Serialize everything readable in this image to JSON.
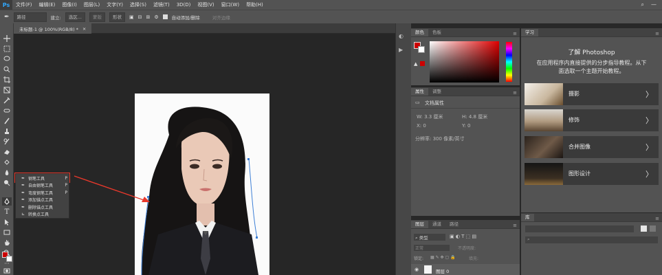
{
  "menubar": {
    "logo": "Ps",
    "items": [
      "文件(F)",
      "编辑(E)",
      "图像(I)",
      "图层(L)",
      "文字(Y)",
      "选择(S)",
      "滤镜(T)",
      "3D(D)",
      "视图(V)",
      "窗口(W)",
      "帮助(H)"
    ]
  },
  "options": {
    "mode": "路径",
    "make_label": "建立:",
    "selection_btn": "选区...",
    "mask_btn": "蒙版",
    "shape_btn": "形状",
    "auto_add_label": "自动添加/删除",
    "align_edges": "对齐边缘"
  },
  "document": {
    "tab_title": "未标题-1 @ 100%(RGB/8) *",
    "close": "×"
  },
  "flyout": {
    "items": [
      {
        "label": "钢笔工具",
        "key": "P"
      },
      {
        "label": "自由钢笔工具",
        "key": "P"
      },
      {
        "label": "弯度钢笔工具",
        "key": "P"
      },
      {
        "label": "添加锚点工具",
        "key": ""
      },
      {
        "label": "删除锚点工具",
        "key": ""
      },
      {
        "label": "转换点工具",
        "key": ""
      }
    ]
  },
  "color_panel": {
    "tabs": [
      "颜色",
      "色板"
    ],
    "foreground": "#cc0000",
    "background": "#ffffff"
  },
  "properties_panel": {
    "tabs": [
      "属性",
      "调整"
    ],
    "section": "文档属性",
    "w_label": "W:",
    "w_value": "3.3 厘米",
    "h_label": "H:",
    "h_value": "4.8 厘米",
    "x_label": "X:",
    "x_value": "0",
    "y_label": "Y:",
    "y_value": "0",
    "resolution": "分辨率: 300 像素/英寸"
  },
  "layers_panel": {
    "tabs": [
      "图层",
      "通道",
      "路径"
    ],
    "filter": "类型",
    "blend": "正常",
    "opacity_label": "不透明度:",
    "lock_label": "锁定:",
    "fill_label": "填充:",
    "layer_name": "图层 0"
  },
  "learn_panel": {
    "tab": "学习",
    "title": "了解 Photoshop",
    "desc_line1": "在应用程序内直接提供的分步指导教程。从下",
    "desc_line2": "面选取一个主题开始教程。",
    "cards": [
      {
        "label": "摄影"
      },
      {
        "label": "修饰"
      },
      {
        "label": "合并图像"
      },
      {
        "label": "图形设计"
      }
    ],
    "chevron": "〉"
  },
  "library_panel": {
    "tab": "库"
  },
  "colors": {
    "accent_red": "#e8382b",
    "ui_dark": "#535353"
  }
}
